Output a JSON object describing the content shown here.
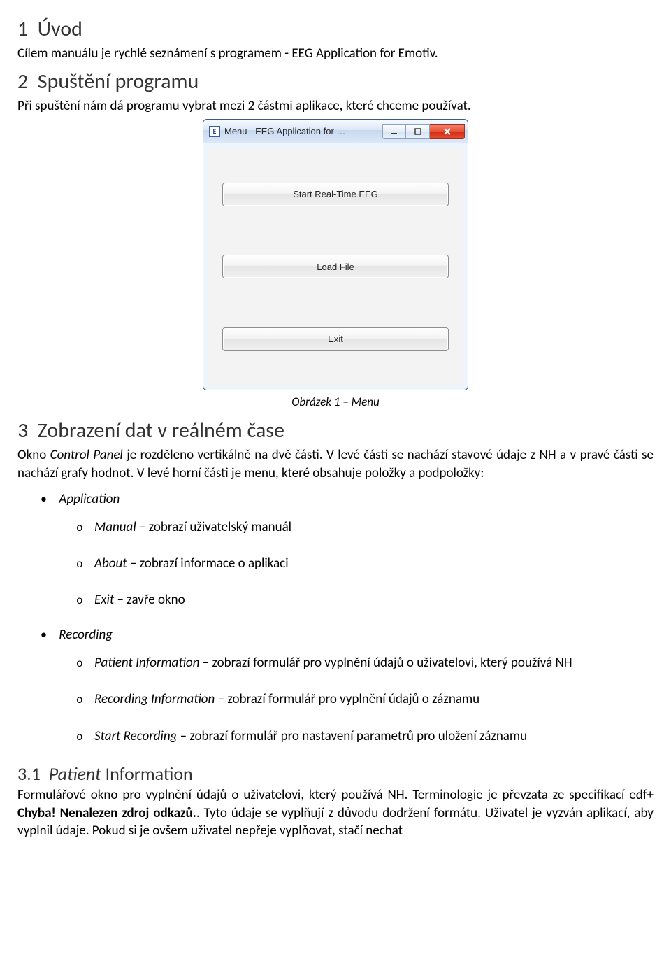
{
  "sec1": {
    "num": "1",
    "title": "Úvod",
    "p1": "Cílem manuálu je rychlé seznámení s programem - EEG Application for Emotiv."
  },
  "sec2": {
    "num": "2",
    "title": "Spuštění programu",
    "p1": "Při spuštění nám dá programu vybrat mezi 2 částmi aplikace, které chceme používat."
  },
  "dialog": {
    "icon_letter": "E",
    "title": "Menu - EEG Application for …",
    "btn1": "Start Real-Time EEG",
    "btn2": "Load File",
    "btn3": "Exit"
  },
  "caption1": "Obrázek 1 – Menu",
  "sec3": {
    "num": "3",
    "title": "Zobrazení dat v reálném čase",
    "p1_a": "Okno ",
    "p1_b": "Control Panel",
    "p1_c": " je rozděleno vertikálně na dvě části. V levé části se nachází stavové údaje z NH a v pravé části se nachází grafy hodnot. V levé horní části je menu, které obsahuje položky a podpoložky:",
    "b1": "Application",
    "b1_1_a": "Manual",
    "b1_1_b": " – zobrazí uživatelský manuál",
    "b1_2_a": "About",
    "b1_2_b": " – zobrazí informace o aplikaci",
    "b1_3_a": "Exit",
    "b1_3_b": " – zavře okno",
    "b2": "Recording",
    "b2_1_a": "Patient Information",
    "b2_1_b": " – zobrazí formulář pro vyplnění údajů o uživatelovi, který používá NH",
    "b2_2_a": "Recording Information",
    "b2_2_b": " – zobrazí formulář pro vyplnění údajů o záznamu",
    "b2_3_a": "Start Recording",
    "b2_3_b": " – zobrazí formulář pro nastavení parametrů pro uložení záznamu"
  },
  "sec31": {
    "num": "3.1",
    "title_a": "Patient",
    "title_b": " Information",
    "p1_a": "Formulářové okno pro vyplnění údajů o uživatelovi, který používá NH. Terminologie je převzata ze specifikací edf+ ",
    "p1_b": "Chyba! Nenalezen zdroj odkazů.",
    "p1_c": ". Tyto údaje se vyplňují z důvodu dodržení formátu. Uživatel je vyzván aplikací, aby vyplnil údaje. Pokud si je ovšem uživatel nepřeje vyplňovat, stačí nechat"
  }
}
